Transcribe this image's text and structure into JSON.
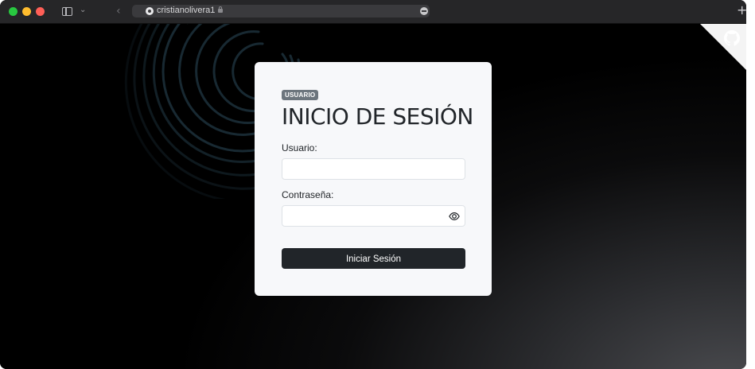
{
  "browser": {
    "url": "cristianolivera1",
    "icons": {
      "traffic_lights": [
        "close-red",
        "minimize-yellow",
        "maximize-green"
      ],
      "sidebar_toggle": "sidebar-icon",
      "tab_overview": "chevron-down-icon",
      "back": "chevron-left-icon",
      "site_favicon": "github-icon",
      "secure": "lock-icon",
      "site_settings": "site-settings-icon",
      "new_tab": "plus-icon"
    },
    "chevron_down": "⌄",
    "back_glyph": "‹",
    "new_tab_glyph": "+"
  },
  "page": {
    "corner_icon": "github-octocat-icon",
    "background_colors": [
      "#000000",
      "#4b4c50"
    ]
  },
  "login": {
    "badge": "USUARIO",
    "title": "INICIO DE SESIÓN",
    "username_label": "Usuario:",
    "username_value": "",
    "password_label": "Contraseña:",
    "password_value": "",
    "password_toggle_icon": "eye-icon",
    "submit_label": "Iniciar Sesión",
    "colors": {
      "card": "#f7f8fa",
      "button": "#212529",
      "badge": "#6c757d"
    }
  }
}
